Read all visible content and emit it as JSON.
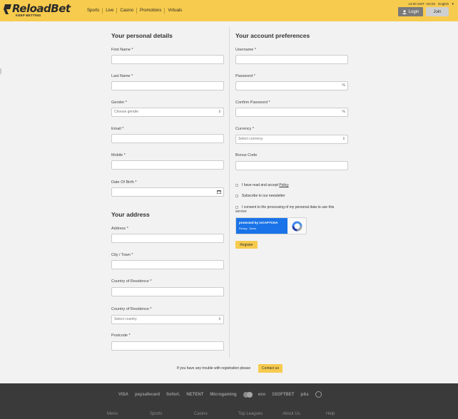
{
  "header": {
    "brand": "ReloadBet",
    "tagline": "KEEP BETTING",
    "nav": [
      "Sports",
      "Live",
      "Casino",
      "Promotions",
      "Virtuals"
    ],
    "time": "13:00 GMT +02:00",
    "language": "English",
    "login_label": "Login",
    "join_label": "Join",
    "accent_color": "#f7cb4d"
  },
  "personal": {
    "title": "Your personal details",
    "first_name_label": "First Name *",
    "last_name_label": "Last Name *",
    "gender_label": "Gender *",
    "gender_value": "Choose gender",
    "email_label": "Email *",
    "mobile_label": "Mobile *",
    "dob_label": "Date Of Birth *"
  },
  "address": {
    "title": "Your address",
    "address_label": "Address *",
    "city_label": "City / Town *",
    "country_residence_label": "Country of Residence *",
    "country_residence2_label": "Country of Residence *",
    "country_value": "Select country",
    "postcode_label": "Postcode *"
  },
  "account": {
    "title": "Your account preferences",
    "username_label": "Username *",
    "password_label": "Password *",
    "confirm_label": "Confirm Password *",
    "currency_label": "Currency *",
    "currency_value": "Select currency",
    "bonus_label": "Bonus Code",
    "pw_suffix": "%",
    "confirm_suffix": "%",
    "accept_text": "I have read and accept",
    "policy_link": "Policy",
    "newsletter_text": "Subscribe to our newsletter",
    "consent_line1": "I consent to the processing of my personal data to use this",
    "consent_line2": "service",
    "captcha_title": "protected by reCAPTCHA",
    "captcha_links": "Privacy - Terms",
    "register_label": "Register"
  },
  "help": {
    "trouble_text": "If you have any trouble with registration please",
    "contact_label": "Contact us"
  },
  "footer": {
    "payments": [
      "VISA",
      "paysafecard",
      "Sofort.",
      "NETENT",
      "Microgaming",
      "eco",
      "1SOFTBET",
      "p&s"
    ],
    "links": [
      "Menu",
      "Sports",
      "Casino",
      "Top Leagues",
      "About Us",
      "Help"
    ]
  }
}
